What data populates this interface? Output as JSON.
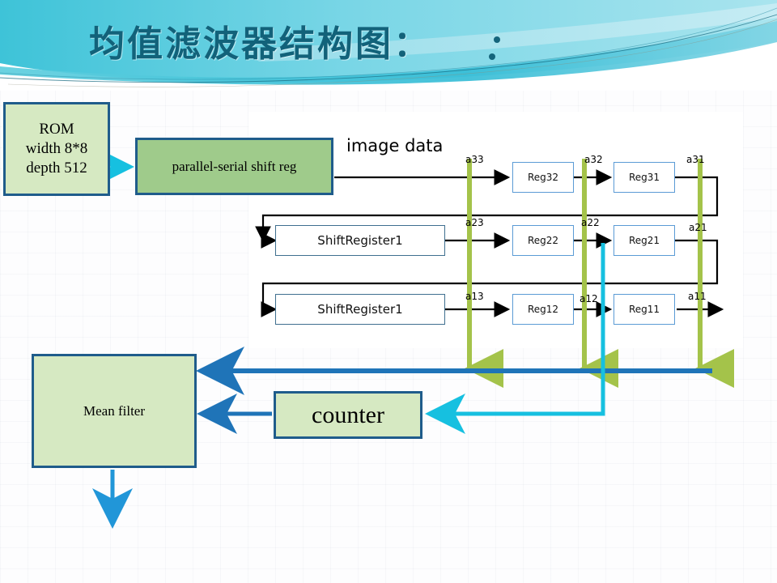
{
  "slide": {
    "title": "均值滤波器结构图：",
    "title_color": "#12627a",
    "banner_colors": [
      "#5ec9dd",
      "#8fdbe8",
      "#2bb7d4",
      "#ffffff"
    ],
    "background_color": "#fdfdfe"
  },
  "blocks": {
    "rom": {
      "lines": [
        "ROM",
        "width 8*8",
        "depth 512"
      ],
      "fill": "#d6e9c2",
      "border": "#1f5c8b"
    },
    "parallel_serial": {
      "label": "parallel-serial shift reg",
      "fill": "#9fcb8b",
      "border": "#1f5c8b"
    },
    "mean_filter": {
      "label": "Mean filter",
      "fill": "#d6e9c2",
      "border": "#1f5c8b"
    },
    "counter": {
      "label": "counter",
      "fill": "#d6e9c2",
      "border": "#1f5c8b"
    }
  },
  "panel": {
    "image_data_label": "image data",
    "rows": [
      {
        "source": null,
        "tap_labels": [
          "a33",
          "a32",
          "a31"
        ],
        "registers": [
          "Reg32",
          "Reg31"
        ]
      },
      {
        "source": "ShiftRegister1",
        "tap_labels": [
          "a23",
          "a22",
          "a21"
        ],
        "registers": [
          "Reg22",
          "Reg21"
        ]
      },
      {
        "source": "ShiftRegister1",
        "tap_labels": [
          "a13",
          "a12",
          "a11"
        ],
        "registers": [
          "Reg12",
          "Reg11"
        ]
      }
    ],
    "register_border_color": "#5b9bd5",
    "shiftregister_border_color": "#3f6f8f"
  },
  "connectors": {
    "tap_line_color": "#a4c34a",
    "bus_color": "#1f74b8",
    "clock_color": "#16c0e0",
    "data_color": "#000000"
  }
}
